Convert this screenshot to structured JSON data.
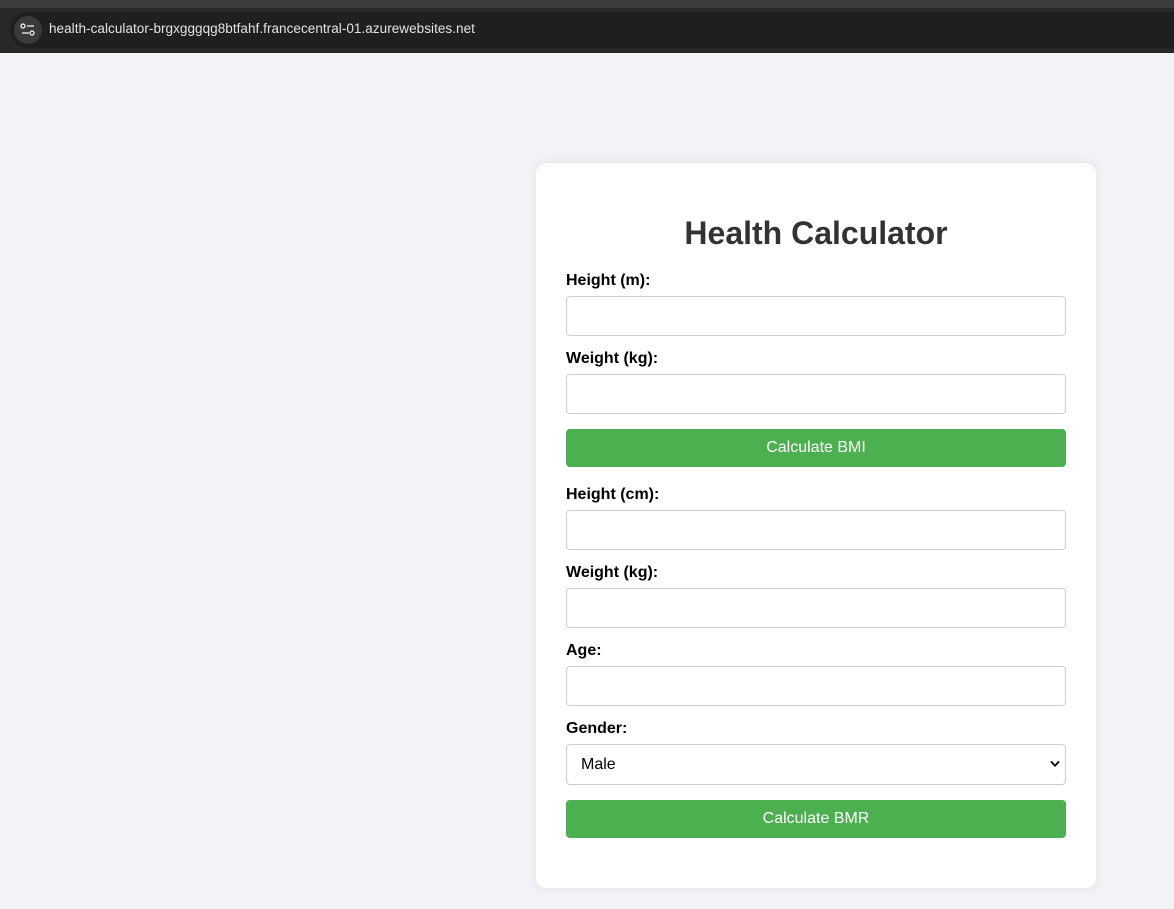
{
  "browser": {
    "url": "health-calculator-brgxgggqg8btfahf.francecentral-01.azurewebsites.net"
  },
  "form": {
    "title": "Health Calculator",
    "bmi": {
      "height_label": "Height (m):",
      "height_value": "",
      "weight_label": "Weight (kg):",
      "weight_value": "",
      "button_label": "Calculate BMI"
    },
    "bmr": {
      "height_label": "Height (cm):",
      "height_value": "",
      "weight_label": "Weight (kg):",
      "weight_value": "",
      "age_label": "Age:",
      "age_value": "",
      "gender_label": "Gender:",
      "gender_selected": "Male",
      "button_label": "Calculate BMR"
    }
  },
  "colors": {
    "page_background": "#f3f3f7",
    "card_background": "#ffffff",
    "button_green": "#4caf50",
    "title_text": "#333333"
  },
  "icons": {
    "site_info": "tune-icon",
    "select_arrow": "chevron-down-icon"
  }
}
